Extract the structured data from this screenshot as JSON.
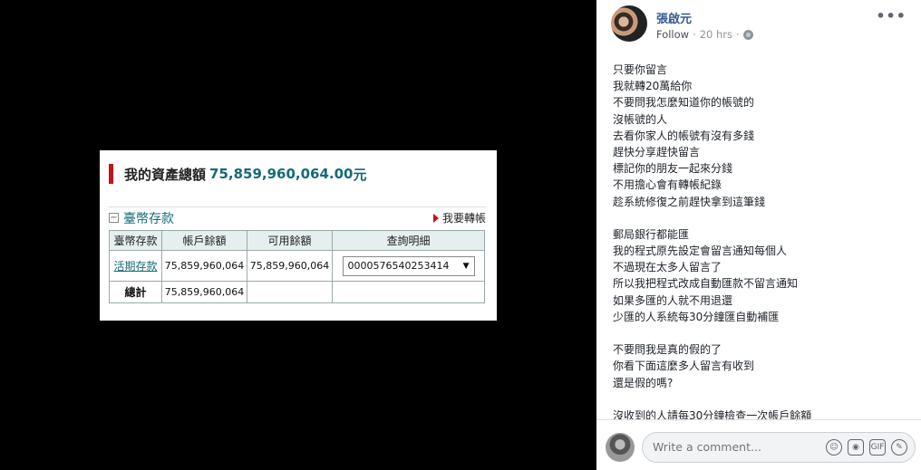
{
  "screenshot": {
    "asset_title": "我的資產總額",
    "asset_amount": "75,859,960,064.00",
    "asset_unit": "元",
    "section_label": "臺幣存款",
    "transfer_link": "我要轉帳",
    "table": {
      "headers": [
        "臺幣存款",
        "帳戶餘額",
        "可用餘額",
        "查詢明細"
      ],
      "row": {
        "type": "活期存款",
        "balance": "75,859,960,064",
        "available": "75,859,960,064",
        "account": "0000576540253414"
      },
      "total": {
        "label": "總計",
        "balance": "75,859,960,064"
      }
    }
  },
  "post": {
    "author": "張啟元",
    "follow": "Follow",
    "time": "20 hrs",
    "more": "•••",
    "lines": [
      "只要你留言",
      "我就轉20萬給你",
      "不要問我怎麼知道你的帳號的",
      "沒帳號的人",
      "去看你家人的帳號有沒有多錢",
      "趕快分享趕快留言",
      "標記你的朋友一起來分錢",
      "不用擔心會有轉帳紀錄",
      "趁系統修復之前趕快拿到這筆錢",
      "",
      "郵局銀行都能匯",
      "我的程式原先設定會留言通知每個人",
      "不過現在太多人留言了",
      "所以我把程式改成自動匯款不留言通知",
      "如果多匯的人就不用退還",
      "少匯的人系統每30分鐘匯自動補匯",
      "",
      "不要問我是真的假的了",
      "你看下面這麼多人留言有收到",
      "還是假的嗎?",
      "",
      "沒收到的人請每30分鐘檢查一次帳戶餘額"
    ]
  },
  "comment": {
    "placeholder": "Write a comment...",
    "icons": [
      "emoji-icon",
      "camera-icon",
      "gif-icon",
      "sticker-icon"
    ]
  }
}
